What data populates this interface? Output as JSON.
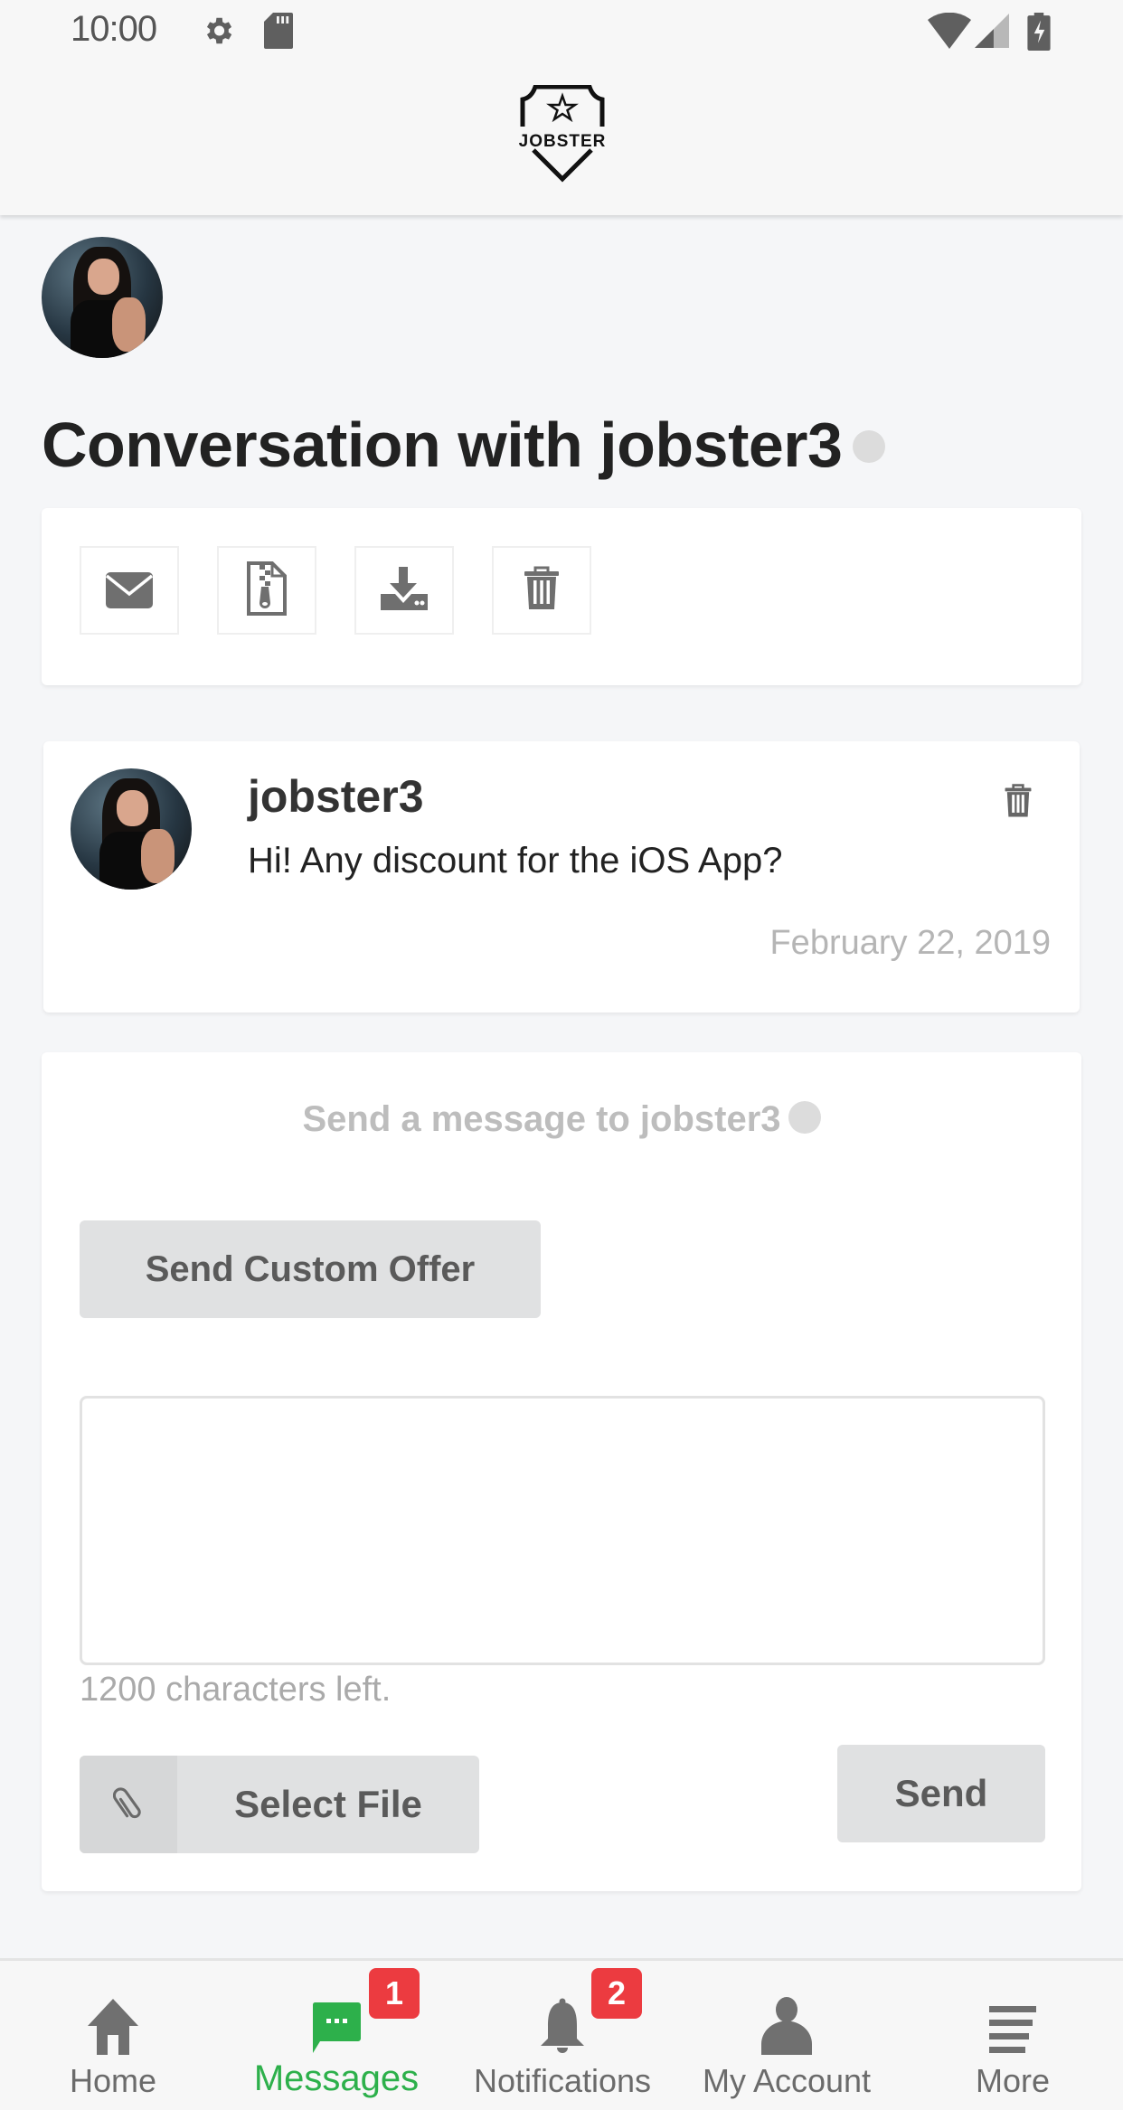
{
  "status_bar": {
    "time": "10:00",
    "left_icons": [
      "gear-icon",
      "sd-card-icon"
    ],
    "right_icons": [
      "wifi-icon",
      "signal-icon",
      "battery-charging-icon"
    ]
  },
  "header": {
    "logo_text": "JOBSTER"
  },
  "conversation": {
    "title": "Conversation with jobster3",
    "online_status": "offline",
    "toolbar": [
      {
        "name": "envelope",
        "icon": "envelope-icon",
        "label": "Mark as unread"
      },
      {
        "name": "zip-file",
        "icon": "zip-file-icon",
        "label": "Download attachments"
      },
      {
        "name": "download",
        "icon": "download-icon",
        "label": "Download conversation"
      },
      {
        "name": "delete",
        "icon": "trash-icon",
        "label": "Delete conversation"
      }
    ]
  },
  "messages": [
    {
      "author": "jobster3",
      "text": "Hi! Any discount for the iOS App?",
      "date": "February 22, 2019"
    }
  ],
  "compose": {
    "heading": "Send a message to jobster3",
    "custom_offer_label": "Send Custom Offer",
    "textarea_value": "",
    "textarea_placeholder": "",
    "char_count": "1200 characters left.",
    "select_file_label": "Select File",
    "send_label": "Send"
  },
  "bottom_nav": {
    "items": [
      {
        "label": "Home",
        "icon": "home-icon",
        "badge": null,
        "active": false
      },
      {
        "label": "Messages",
        "icon": "chat-icon",
        "badge": "1",
        "active": true
      },
      {
        "label": "Notifications",
        "icon": "bell-icon",
        "badge": "2",
        "active": false
      },
      {
        "label": "My Account",
        "icon": "user-icon",
        "badge": null,
        "active": false
      },
      {
        "label": "More",
        "icon": "menu-icon",
        "badge": null,
        "active": false
      }
    ]
  },
  "colors": {
    "accent": "#2db04b",
    "badge": "#ec3b40",
    "icon_grey": "#6b6b6b",
    "button_grey": "#e0e1e2"
  }
}
